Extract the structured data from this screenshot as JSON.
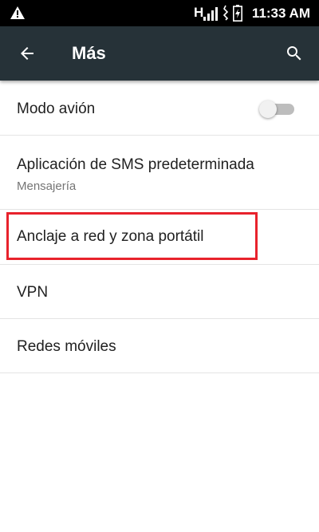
{
  "status_bar": {
    "network_type": "H",
    "time": "11:33 AM",
    "icons": [
      "warning-icon",
      "signal-icon",
      "vibrate-icon",
      "battery-charging-icon"
    ]
  },
  "toolbar": {
    "title": "Más",
    "back_icon": "arrow-back-icon",
    "search_icon": "search-icon",
    "background_color": "#263238"
  },
  "settings": {
    "items": [
      {
        "label": "Modo avión",
        "toggle": {
          "state": "off"
        }
      },
      {
        "label": "Aplicación de SMS predeterminada",
        "summary": "Mensajería"
      },
      {
        "label": "Anclaje a red y zona portátil",
        "highlighted": true,
        "highlight_color": "#e8222c"
      },
      {
        "label": "VPN"
      },
      {
        "label": "Redes móviles"
      }
    ]
  }
}
